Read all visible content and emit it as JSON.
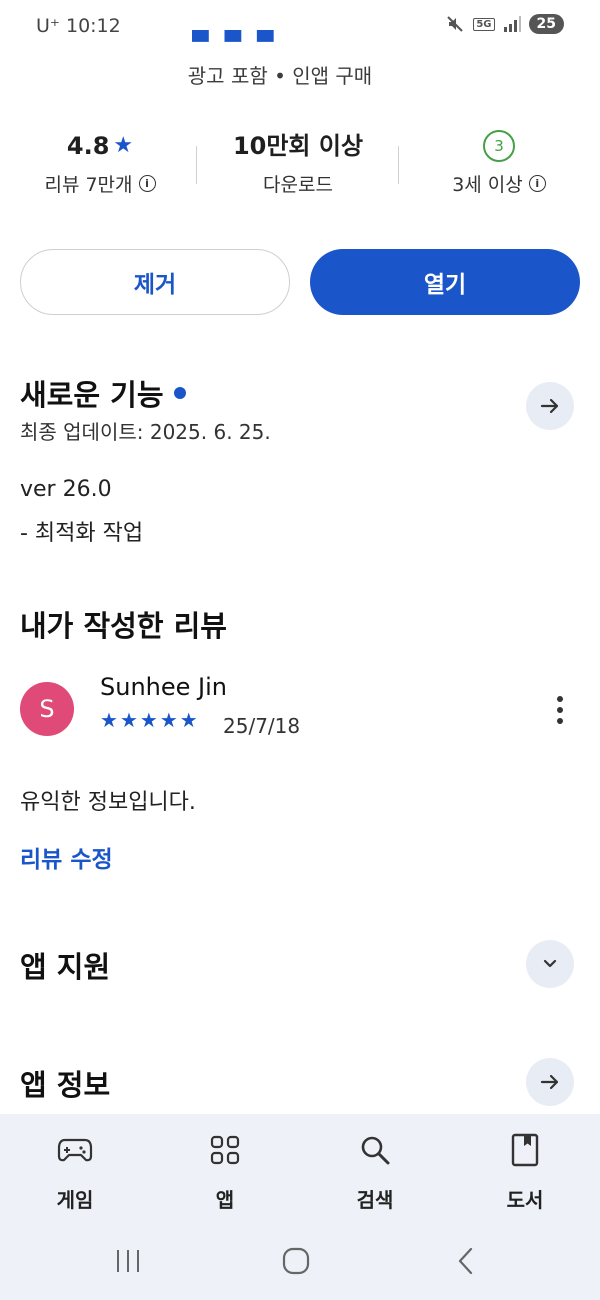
{
  "status_bar": {
    "carrier": "U⁺ 10:12",
    "network": "5G",
    "battery": "25"
  },
  "app": {
    "ad_info": "광고 포함 • 인앱 구매"
  },
  "stats": {
    "rating": "4.8",
    "rating_star": "★",
    "reviews": "리뷰 7만개",
    "downloads": "10만회 이상",
    "downloads_label": "다운로드",
    "age_number": "3",
    "age_label": "3세 이상",
    "info_glyph": "i"
  },
  "actions": {
    "remove_label": "제거",
    "open_label": "열기"
  },
  "whats_new": {
    "title": "새로운 기능",
    "updated": "최종 업데이트: 2025. 6. 25.",
    "version": "ver 26.0",
    "note": "- 최적화 작업"
  },
  "my_review": {
    "title": "내가 작성한 리뷰",
    "avatar_letter": "S",
    "reviewer": "Sunhee Jin",
    "rating": 5,
    "date": "25/7/18",
    "text": "유익한 정보입니다.",
    "edit_label": "리뷰 수정"
  },
  "sections": {
    "support": "앱 지원",
    "info": "앱 정보"
  },
  "bottom_nav": {
    "items": [
      {
        "label": "게임",
        "icon": "gamepad-icon"
      },
      {
        "label": "앱",
        "icon": "apps-grid-icon"
      },
      {
        "label": "검색",
        "icon": "search-icon"
      },
      {
        "label": "도서",
        "icon": "book-icon"
      }
    ]
  },
  "colors": {
    "accent": "#1a56c9",
    "avatar": "#e04a78",
    "age_badge": "#43a047",
    "nav_bg": "#eef1f7"
  }
}
